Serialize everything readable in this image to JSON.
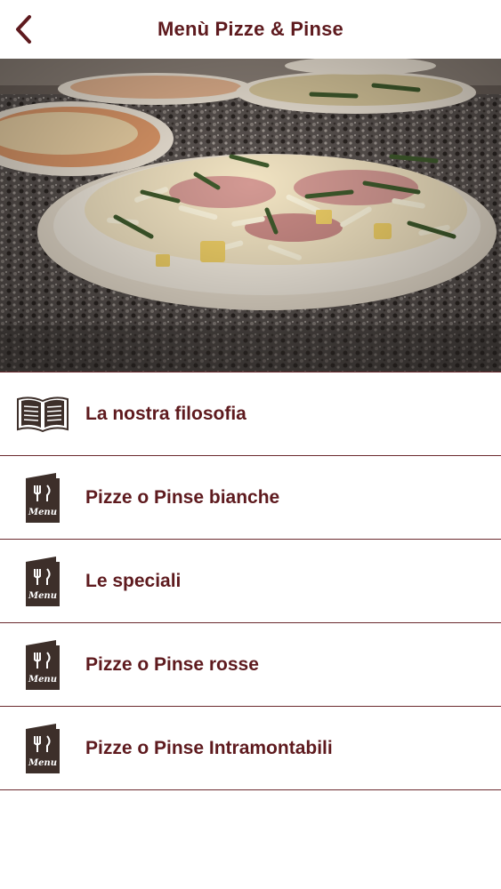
{
  "header": {
    "title": "Menù Pizze & Pinse",
    "back_icon": "chevron-left-icon"
  },
  "hero": {
    "description_icon": "pizza-photo"
  },
  "menu": {
    "items": [
      {
        "label": "La nostra filosofia",
        "icon": "open-book-icon"
      },
      {
        "label": "Pizze o Pinse bianche",
        "icon": "menu-booklet-icon"
      },
      {
        "label": "Le speciali",
        "icon": "menu-booklet-icon"
      },
      {
        "label": "Pizze o Pinse rosse",
        "icon": "menu-booklet-icon"
      },
      {
        "label": "Pizze o Pinse Intramontabili",
        "icon": "menu-booklet-icon"
      }
    ],
    "booklet_text": "Menu"
  },
  "colors": {
    "brand": "#5e1a1e",
    "icon_dark": "#3d2f2a",
    "divider": "#6b2a2e"
  }
}
